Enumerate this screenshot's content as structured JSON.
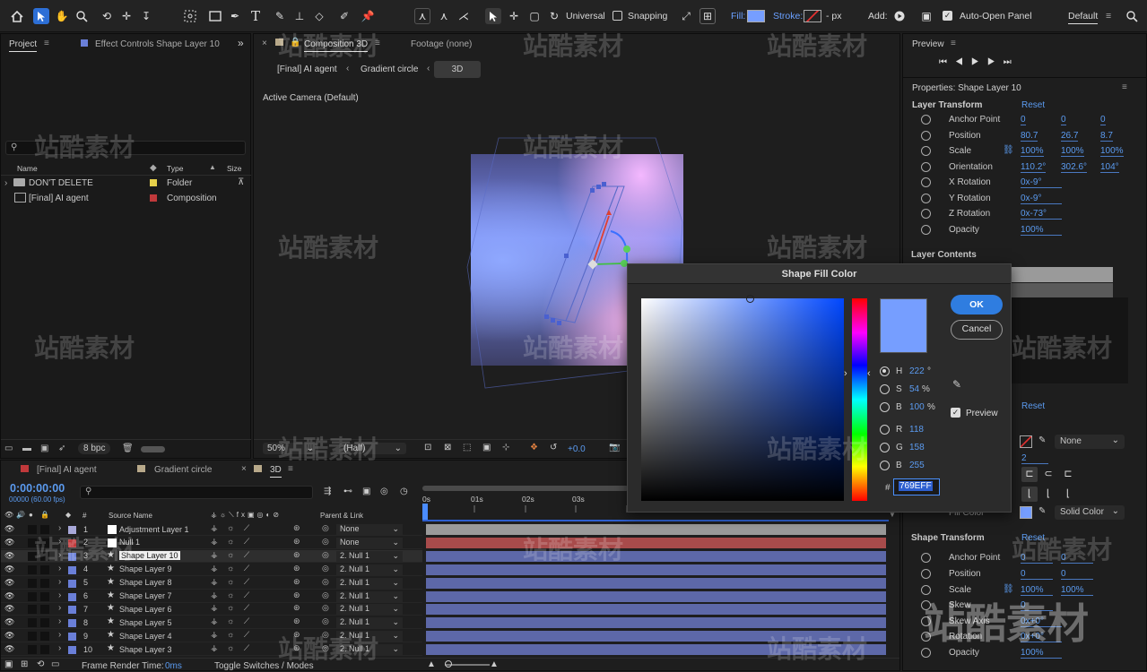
{
  "toolbar": {
    "universal": "Universal",
    "snapping": "Snapping",
    "fill_label": "Fill:",
    "stroke_label": "Stroke:",
    "stroke_unit": "- px",
    "add_label": "Add:",
    "auto_open_panel": "Auto-Open Panel",
    "workspace": "Default",
    "fill_color": "#769EFF"
  },
  "project_panel": {
    "tab_project": "Project",
    "tab_effect_controls": "Effect Controls Shape Layer 10",
    "col_name": "Name",
    "col_type": "Type",
    "col_size": "Size",
    "items": [
      {
        "name": "DON'T DELETE",
        "type": "Folder",
        "label_color": "#e6d04a"
      },
      {
        "name": "[Final] AI agent",
        "type": "Composition",
        "label_color": "#c0393b"
      }
    ],
    "bpc": "8 bpc"
  },
  "composition_panel": {
    "tab_composition": "Composition 3D",
    "tab_footage": "Footage (none)",
    "breadcrumb": [
      "[Final] AI agent",
      "Gradient circle",
      "3D"
    ],
    "camera_label": "Active Camera (Default)",
    "zoom": "50%",
    "resolution": "(Half)",
    "exposure": "+0.0"
  },
  "preview_panel": {
    "title": "Preview"
  },
  "properties_panel": {
    "title": "Properties: Shape Layer 10",
    "layer_transform": "Layer Transform",
    "reset": "Reset",
    "props": [
      {
        "label": "Anchor Point",
        "values": [
          "0",
          "0",
          "0"
        ]
      },
      {
        "label": "Position",
        "values": [
          "80.7",
          "26.7",
          "8.7"
        ]
      },
      {
        "label": "Scale",
        "values": [
          "100%",
          "100%",
          "100%"
        ]
      },
      {
        "label": "Orientation",
        "values": [
          "110.2°",
          "302.6°",
          "104°"
        ]
      },
      {
        "label": "X Rotation",
        "values": [
          "0x-9°"
        ]
      },
      {
        "label": "Y Rotation",
        "values": [
          "0x-9°"
        ]
      },
      {
        "label": "Z Rotation",
        "values": [
          "0x-73°"
        ]
      },
      {
        "label": "Opacity",
        "values": [
          "100%"
        ]
      }
    ],
    "layer_contents": "Layer Contents",
    "reset2": "Reset",
    "stroke_type": "None",
    "stroke_width": "2",
    "fill_color_label": "Fill Color",
    "fill_type": "Solid Color",
    "shape_transform": "Shape Transform",
    "reset3": "Reset",
    "shape_props": [
      {
        "label": "Anchor Point",
        "values": [
          "0",
          "0"
        ]
      },
      {
        "label": "Position",
        "values": [
          "0",
          "0"
        ]
      },
      {
        "label": "Scale",
        "values": [
          "100%",
          "100%"
        ]
      },
      {
        "label": "Skew",
        "values": [
          "0"
        ]
      },
      {
        "label": "Skew Axis",
        "values": [
          "0x+0°"
        ]
      },
      {
        "label": "Rotation",
        "values": [
          "0x+0°"
        ]
      },
      {
        "label": "Opacity",
        "values": [
          "100%"
        ]
      }
    ]
  },
  "timeline": {
    "tabs": [
      "[Final] AI agent",
      "Gradient circle",
      "3D"
    ],
    "timecode": "0:00:00:00",
    "fps": "00000 (60.00 fps)",
    "col_source": "Source Name",
    "col_parent": "Parent & Link",
    "ruler": [
      "0s",
      "01s",
      "02s",
      "03s"
    ],
    "layers": [
      {
        "num": "1",
        "name": "Adjustment Layer 1",
        "parent": "None",
        "color": "#a8a8d8",
        "bar": "#9a9a9a",
        "icon": "white-square"
      },
      {
        "num": "2",
        "name": "Null 1",
        "parent": "None",
        "color": "#c0393b",
        "bar": "#a84b4b",
        "icon": "white-square"
      },
      {
        "num": "3",
        "name": "Shape Layer 10",
        "parent": "2. Null 1",
        "color": "#6a7fd8",
        "bar": "#5d68a8",
        "icon": "star",
        "selected": true
      },
      {
        "num": "4",
        "name": "Shape Layer 9",
        "parent": "2. Null 1",
        "color": "#6a7fd8",
        "bar": "#5d68a8",
        "icon": "star"
      },
      {
        "num": "5",
        "name": "Shape Layer 8",
        "parent": "2. Null 1",
        "color": "#6a7fd8",
        "bar": "#5d68a8",
        "icon": "star"
      },
      {
        "num": "6",
        "name": "Shape Layer 7",
        "parent": "2. Null 1",
        "color": "#6a7fd8",
        "bar": "#5d68a8",
        "icon": "star"
      },
      {
        "num": "7",
        "name": "Shape Layer 6",
        "parent": "2. Null 1",
        "color": "#6a7fd8",
        "bar": "#5d68a8",
        "icon": "star"
      },
      {
        "num": "8",
        "name": "Shape Layer 5",
        "parent": "2. Null 1",
        "color": "#6a7fd8",
        "bar": "#5d68a8",
        "icon": "star"
      },
      {
        "num": "9",
        "name": "Shape Layer 4",
        "parent": "2. Null 1",
        "color": "#6a7fd8",
        "bar": "#5d68a8",
        "icon": "star"
      },
      {
        "num": "10",
        "name": "Shape Layer 3",
        "parent": "2. Null 1",
        "color": "#6a7fd8",
        "bar": "#5d68a8",
        "icon": "star"
      }
    ],
    "frame_render_label": "Frame Render Time:",
    "frame_render_value": "0ms",
    "toggle_switches": "Toggle Switches / Modes"
  },
  "color_dialog": {
    "title": "Shape Fill Color",
    "ok": "OK",
    "cancel": "Cancel",
    "preview_label": "Preview",
    "h_label": "H",
    "h_value": "222",
    "h_unit": "°",
    "s_label": "S",
    "s_value": "54",
    "s_unit": "%",
    "b_label": "B",
    "b_value": "100",
    "b_unit": "%",
    "r_label": "R",
    "r_value": "118",
    "g_label": "G",
    "g_value": "158",
    "bb_label": "B",
    "bb_value": "255",
    "hash": "#",
    "hex": "769EFF",
    "color": "#769EFF"
  },
  "watermark": "站酷素材"
}
